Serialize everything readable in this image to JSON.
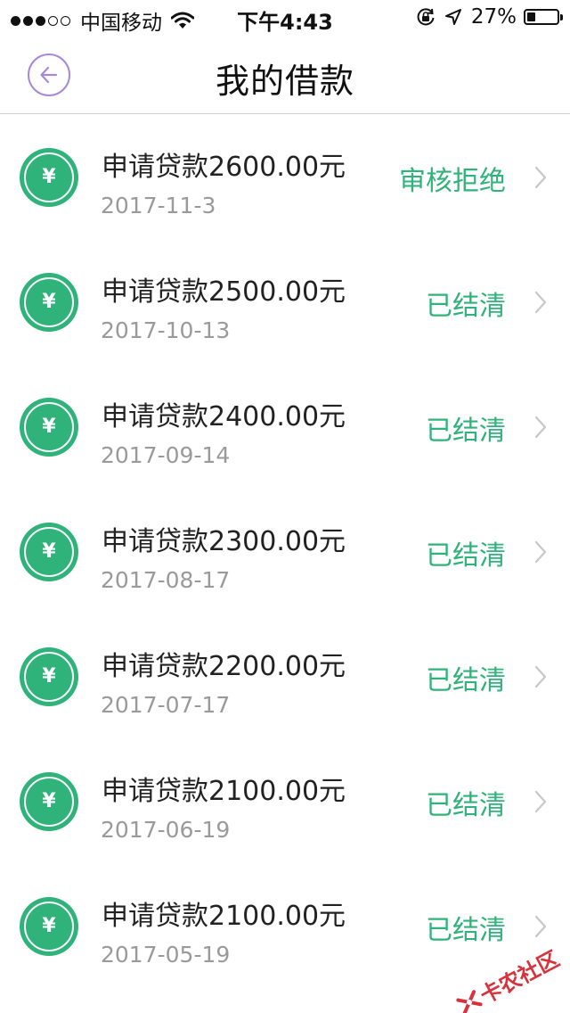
{
  "status_bar": {
    "signal_full": 3,
    "signal_empty": 2,
    "carrier": "中国移动",
    "time": "下午4:43",
    "battery_percent": "27%",
    "battery_level": 0.27,
    "icons": [
      "wifi-icon",
      "rotation-lock-icon",
      "location-arrow-icon",
      "battery-icon"
    ]
  },
  "nav": {
    "title": "我的借款",
    "back_icon": "back-arrow-icon",
    "accent_color": "#a68ad9"
  },
  "loans": [
    {
      "title": "申请贷款2600.00元",
      "date": "2017-11-3",
      "status": "审核拒绝"
    },
    {
      "title": "申请贷款2500.00元",
      "date": "2017-10-13",
      "status": "已结清"
    },
    {
      "title": "申请贷款2400.00元",
      "date": "2017-09-14",
      "status": "已结清"
    },
    {
      "title": "申请贷款2300.00元",
      "date": "2017-08-17",
      "status": "已结清"
    },
    {
      "title": "申请贷款2200.00元",
      "date": "2017-07-17",
      "status": "已结清"
    },
    {
      "title": "申请贷款2100.00元",
      "date": "2017-06-19",
      "status": "已结清"
    },
    {
      "title": "申请贷款2100.00元",
      "date": "2017-05-19",
      "status": "已结清"
    }
  ],
  "coin_symbol": "¥",
  "colors": {
    "green": "#2fb37a",
    "date_gray": "#9a9a9a",
    "chevron": "#c7c7cc"
  },
  "watermark": {
    "text": "卡农社区",
    "color": "#d8323d"
  }
}
